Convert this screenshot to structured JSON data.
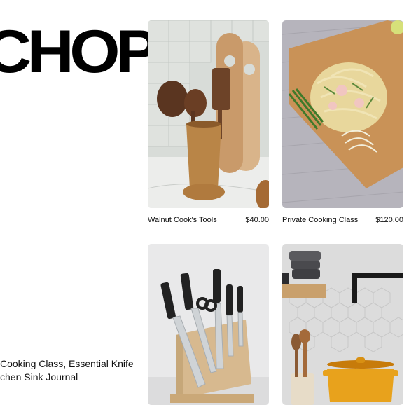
{
  "brand": {
    "wordmark": "CHOP"
  },
  "sidebar": {
    "text_lines": [
      "Cooking Class, Essential Knife",
      "chen Sink Journal"
    ]
  },
  "products": [
    {
      "name": "Walnut Cook's Tools",
      "price": "$40.00"
    },
    {
      "name": "Private Cooking Class",
      "price": "$120.00"
    },
    {
      "name": "",
      "price": ""
    },
    {
      "name": "",
      "price": ""
    }
  ],
  "colors": {
    "background": "#ffffff",
    "text": "#111111",
    "accent_pot": "#e8a21c"
  }
}
